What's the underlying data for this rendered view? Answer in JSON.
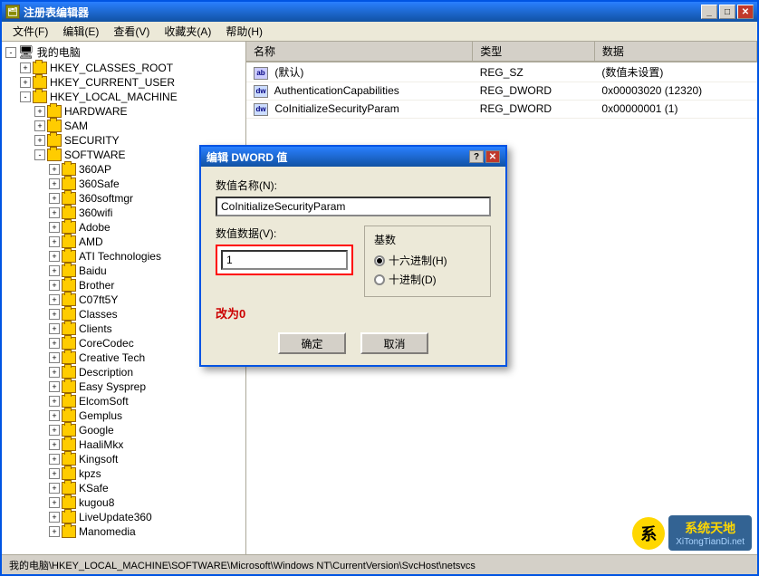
{
  "window": {
    "title": "注册表编辑器",
    "title_icon": "🗂"
  },
  "menu": {
    "items": [
      "文件(F)",
      "编辑(E)",
      "查看(V)",
      "收藏夹(A)",
      "帮助(H)"
    ]
  },
  "tree": {
    "items": [
      {
        "id": "mypc",
        "label": "我的电脑",
        "indent": 0,
        "expanded": true,
        "icon": "computer"
      },
      {
        "id": "hkcr",
        "label": "HKEY_CLASSES_ROOT",
        "indent": 1,
        "expanded": false
      },
      {
        "id": "hkcu",
        "label": "HKEY_CURRENT_USER",
        "indent": 1,
        "expanded": false
      },
      {
        "id": "hklm",
        "label": "HKEY_LOCAL_MACHINE",
        "indent": 1,
        "expanded": true
      },
      {
        "id": "hardware",
        "label": "HARDWARE",
        "indent": 2,
        "expanded": false
      },
      {
        "id": "sam",
        "label": "SAM",
        "indent": 2,
        "expanded": false
      },
      {
        "id": "security",
        "label": "SECURITY",
        "indent": 2,
        "expanded": false
      },
      {
        "id": "software",
        "label": "SOFTWARE",
        "indent": 2,
        "expanded": true
      },
      {
        "id": "360ap",
        "label": "360AP",
        "indent": 3,
        "expanded": false
      },
      {
        "id": "360safe",
        "label": "360Safe",
        "indent": 3,
        "expanded": false
      },
      {
        "id": "360softmgr",
        "label": "360softmgr",
        "indent": 3,
        "expanded": false
      },
      {
        "id": "360wifi",
        "label": "360wifi",
        "indent": 3,
        "expanded": false
      },
      {
        "id": "adobe",
        "label": "Adobe",
        "indent": 3,
        "expanded": false
      },
      {
        "id": "amd",
        "label": "AMD",
        "indent": 3,
        "expanded": false
      },
      {
        "id": "ati",
        "label": "ATI Technologies",
        "indent": 3,
        "expanded": false
      },
      {
        "id": "baidu",
        "label": "Baidu",
        "indent": 3,
        "expanded": false
      },
      {
        "id": "brother",
        "label": "Brother",
        "indent": 3,
        "expanded": false
      },
      {
        "id": "co7ft5y",
        "label": "C07ft5Y",
        "indent": 3,
        "expanded": false
      },
      {
        "id": "classes",
        "label": "Classes",
        "indent": 3,
        "expanded": false
      },
      {
        "id": "clients",
        "label": "Clients",
        "indent": 3,
        "expanded": false
      },
      {
        "id": "corecodec",
        "label": "CoreCodec",
        "indent": 3,
        "expanded": false
      },
      {
        "id": "creativetech",
        "label": "Creative Tech",
        "indent": 3,
        "expanded": false
      },
      {
        "id": "description",
        "label": "Description",
        "indent": 3,
        "expanded": false
      },
      {
        "id": "easysysprep",
        "label": "Easy Sysprep",
        "indent": 3,
        "expanded": false
      },
      {
        "id": "elcomsoft",
        "label": "ElcomSoft",
        "indent": 3,
        "expanded": false
      },
      {
        "id": "gemplus",
        "label": "Gemplus",
        "indent": 3,
        "expanded": false
      },
      {
        "id": "google",
        "label": "Google",
        "indent": 3,
        "expanded": false
      },
      {
        "id": "haalimkx",
        "label": "HaaliMkx",
        "indent": 3,
        "expanded": false
      },
      {
        "id": "kingsoft",
        "label": "Kingsoft",
        "indent": 3,
        "expanded": false
      },
      {
        "id": "kpzs",
        "label": "kpzs",
        "indent": 3,
        "expanded": false
      },
      {
        "id": "ksafe",
        "label": "KSafe",
        "indent": 3,
        "expanded": false
      },
      {
        "id": "kugou8",
        "label": "kugou8",
        "indent": 3,
        "expanded": false
      },
      {
        "id": "liveupdate360",
        "label": "LiveUpdate360",
        "indent": 3,
        "expanded": false
      },
      {
        "id": "manomedia",
        "label": "Manomedia",
        "indent": 3,
        "expanded": false
      }
    ]
  },
  "registry_table": {
    "columns": [
      "名称",
      "类型",
      "数据"
    ],
    "rows": [
      {
        "name": "(默认)",
        "type": "REG_SZ",
        "data": "(数值未设置)",
        "icon": "ab"
      },
      {
        "name": "AuthenticationCapabilities",
        "type": "REG_DWORD",
        "data": "0x00003020 (12320)",
        "icon": "dword"
      },
      {
        "name": "CoInitializeSecurityParam",
        "type": "REG_DWORD",
        "data": "0x00000001 (1)",
        "icon": "dword"
      }
    ]
  },
  "status_bar": {
    "text": "我的电脑\\HKEY_LOCAL_MACHINE\\SOFTWARE\\Microsoft\\Windows NT\\CurrentVersion\\SvcHost\\netsvcs"
  },
  "dialog": {
    "title": "编辑 DWORD 值",
    "name_label": "数值名称(N):",
    "name_value": "CoInitializeSecurityParam",
    "data_label": "数值数据(V):",
    "data_value": "1",
    "base_label": "基数",
    "radio_hex": "十六进制(H)",
    "radio_dec": "十进制(D)",
    "change_text": "改为0",
    "btn_ok": "确定",
    "btn_cancel": "取消",
    "hex_selected": true
  },
  "watermark": {
    "logo": "系",
    "line1": "系统天地",
    "line2": "XiTongTianDi.net"
  }
}
